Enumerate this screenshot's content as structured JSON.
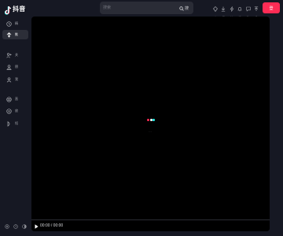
{
  "app": {
    "logo_text": "抖音"
  },
  "search": {
    "placeholder": "搜索",
    "button_label": "搜",
    "icon": "search-icon"
  },
  "top_actions": [
    {
      "icon": "diamond-icon",
      "label": "充"
    },
    {
      "icon": "download-icon",
      "label": "下"
    },
    {
      "icon": "bolt-icon",
      "label": "快"
    },
    {
      "icon": "bell-icon",
      "label": "通"
    },
    {
      "icon": "message-icon",
      "label": "私"
    },
    {
      "icon": "upload-icon",
      "label": "投"
    }
  ],
  "login": {
    "label": "登"
  },
  "sidebar": {
    "items": [
      {
        "icon": "recommend-icon",
        "label": "精",
        "active": false
      },
      {
        "icon": "flame-icon",
        "label": "推",
        "active": true
      },
      {
        "icon": "follow-icon",
        "label": "关",
        "active": false
      },
      {
        "icon": "friends-icon",
        "label": "朋",
        "active": false
      },
      {
        "icon": "user-icon",
        "label": "我",
        "active": false
      },
      {
        "icon": "live-icon",
        "label": "直",
        "active": false
      },
      {
        "icon": "video-icon",
        "label": "放",
        "active": false
      },
      {
        "icon": "play-icon",
        "label": "短",
        "active": false
      }
    ],
    "bottom": [
      "settings-icon",
      "help-icon",
      "theme-icon"
    ]
  },
  "player": {
    "loading_text": "…",
    "time_display": "00:00 / 00:00",
    "loader_colors": [
      "#fe2c55",
      "#ffffff",
      "#25f4ee"
    ]
  },
  "colors": {
    "background": "#161823",
    "accent": "#fe2c55",
    "secondary_accent": "#25f4ee"
  }
}
